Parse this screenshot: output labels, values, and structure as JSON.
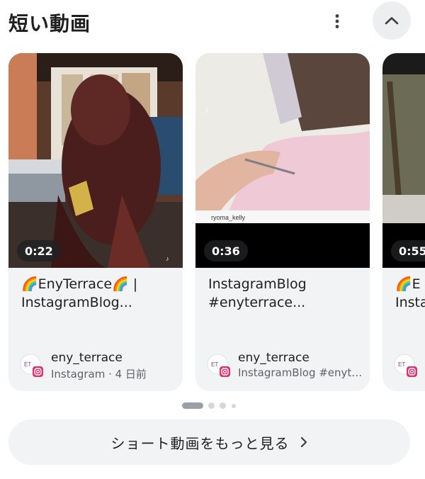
{
  "header": {
    "title": "短い動画",
    "more_icon": "more-vert-icon",
    "collapse_icon": "chevron-up-icon"
  },
  "cards": [
    {
      "duration": "0:22",
      "title": "🌈EnyTerrace🌈 |\nInstagramBlog...",
      "author": "eny_terrace",
      "meta": "Instagram · 4 日前"
    },
    {
      "duration": "0:36",
      "title": "InstagramBlog\n#enyterrace...",
      "author": "eny_terrace",
      "meta": "InstagramBlog #enyt…",
      "watermark": "ryoma_kelly"
    },
    {
      "duration": "0:55",
      "title": "🌈E\nInsta",
      "author": "",
      "meta": ""
    }
  ],
  "show_more": {
    "label": "ショート動画をもっと見る",
    "icon": "chevron-right-icon"
  },
  "colors": {
    "card_bg": "#f1f3f4",
    "duration_bg": "#202124",
    "dot_active": "#9aa0a6",
    "dot_inactive": "#d5d7da"
  }
}
